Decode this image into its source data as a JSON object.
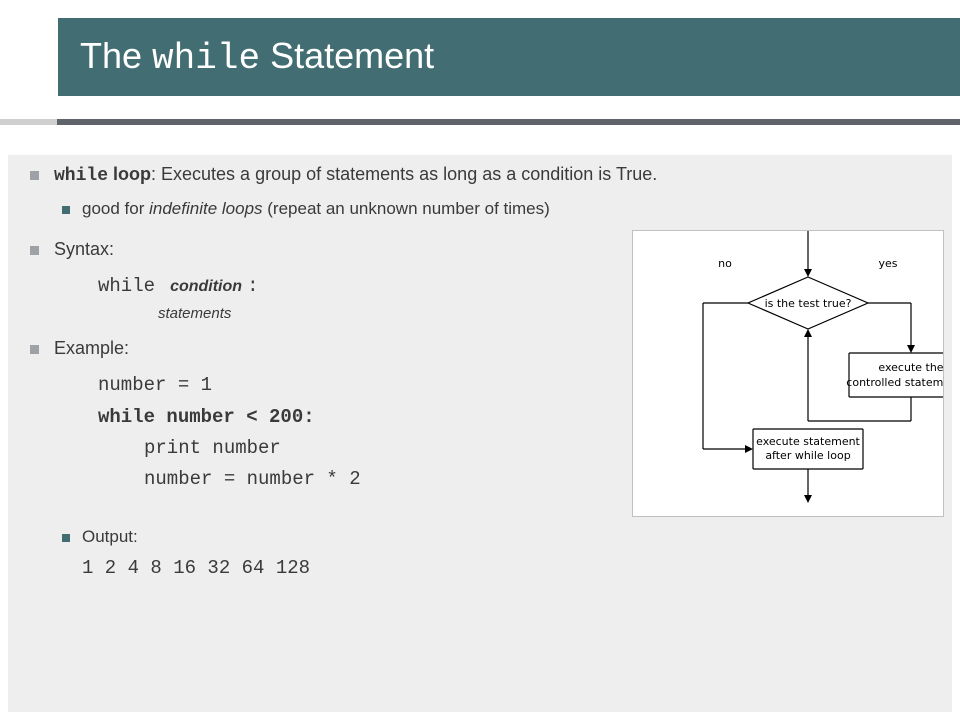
{
  "title": {
    "pre": "The ",
    "code": "while",
    "post": " Statement"
  },
  "b1": {
    "term": "while",
    "label": " loop",
    "desc": ": Executes a group of statements as long as a condition is True."
  },
  "b1sub": {
    "pre": "good for ",
    "em": "indefinite loops",
    "post": " (repeat an unknown number of times)"
  },
  "syntax": {
    "label": "Syntax:",
    "kw": "while",
    "cond": "condition",
    "colon": ":",
    "stmts": "statements"
  },
  "example": {
    "label": "Example:",
    "line1": "number = 1",
    "line2": "while number < 200:",
    "line3": "print number",
    "line4": "number = number * 2"
  },
  "output": {
    "label": "Output:",
    "text": "1 2 4 8 16 32 64 128"
  },
  "flow": {
    "decision": "is the test true?",
    "no": "no",
    "yes": "yes",
    "exec1a": "execute the",
    "exec1b": "controlled statement(s)",
    "exec2a": "execute statement",
    "exec2b": "after while loop"
  }
}
